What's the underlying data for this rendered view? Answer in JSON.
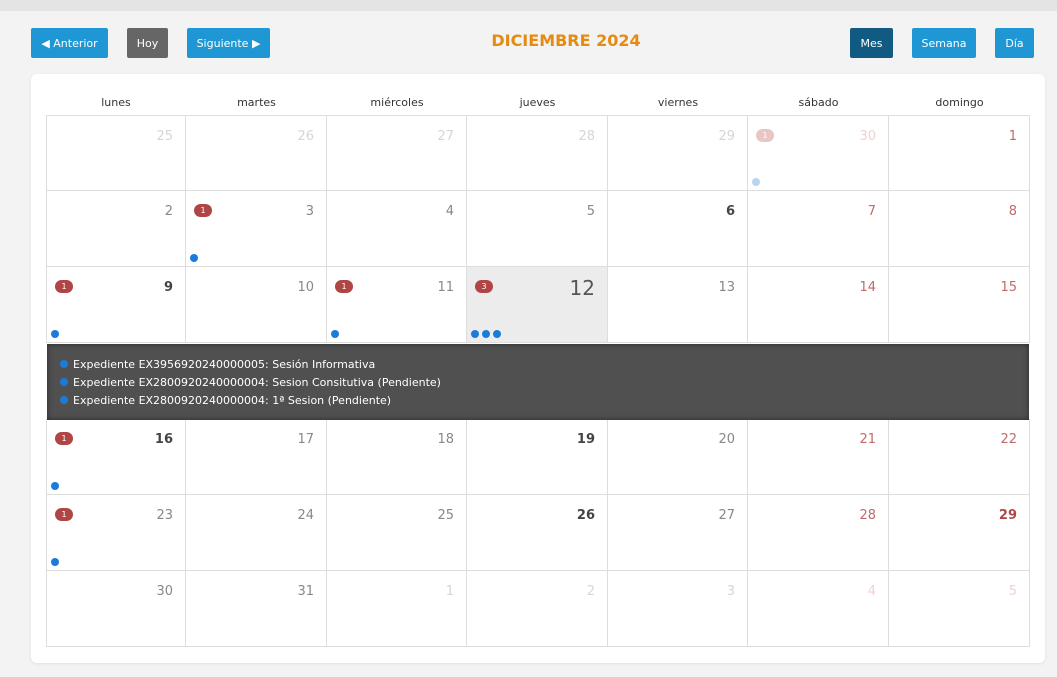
{
  "toolbar": {
    "prev_label": "◀ Anterior",
    "today_label": "Hoy",
    "next_label": "Siguiente ▶",
    "title": "DICIEMBRE 2024",
    "view_month": "Mes",
    "view_week": "Semana",
    "view_day": "Día"
  },
  "weekdays": [
    "lunes",
    "martes",
    "miércoles",
    "jueves",
    "viernes",
    "sábado",
    "domingo"
  ],
  "weeks": [
    [
      {
        "day": "25",
        "dim": true
      },
      {
        "day": "26",
        "dim": true
      },
      {
        "day": "27",
        "dim": true
      },
      {
        "day": "28",
        "dim": true
      },
      {
        "day": "29",
        "dim": true
      },
      {
        "day": "30",
        "dim": true,
        "weekend": true,
        "badge": "1",
        "dots": 1
      },
      {
        "day": "1",
        "weekend": true
      }
    ],
    [
      {
        "day": "2"
      },
      {
        "day": "3",
        "badge": "1",
        "dots": 1
      },
      {
        "day": "4"
      },
      {
        "day": "5"
      },
      {
        "day": "6",
        "bold": true
      },
      {
        "day": "7",
        "weekend": true
      },
      {
        "day": "8",
        "weekend": true
      }
    ],
    [
      {
        "day": "9",
        "bold": true,
        "badge": "1",
        "dots": 1
      },
      {
        "day": "10"
      },
      {
        "day": "11",
        "badge": "1",
        "dots": 1
      },
      {
        "day": "12",
        "today": true,
        "badge": "3",
        "dots": 3
      },
      {
        "day": "13"
      },
      {
        "day": "14",
        "weekend": true
      },
      {
        "day": "15",
        "weekend": true
      }
    ],
    [
      {
        "day": "16",
        "bold": true,
        "badge": "1",
        "dots": 1
      },
      {
        "day": "17"
      },
      {
        "day": "18"
      },
      {
        "day": "19",
        "bold": true
      },
      {
        "day": "20"
      },
      {
        "day": "21",
        "weekend": true
      },
      {
        "day": "22",
        "weekend": true
      }
    ],
    [
      {
        "day": "23",
        "badge": "1",
        "dots": 1
      },
      {
        "day": "24"
      },
      {
        "day": "25"
      },
      {
        "day": "26",
        "bold": true
      },
      {
        "day": "27"
      },
      {
        "day": "28",
        "weekend": true
      },
      {
        "day": "29",
        "weekend": true,
        "bold": true
      }
    ],
    [
      {
        "day": "30"
      },
      {
        "day": "31"
      },
      {
        "day": "1",
        "dim": true
      },
      {
        "day": "2",
        "dim": true
      },
      {
        "day": "3",
        "dim": true
      },
      {
        "day": "4",
        "dim": true,
        "weekend": true
      },
      {
        "day": "5",
        "dim": true,
        "weekend": true
      }
    ]
  ],
  "events": [
    "Expediente EX39569202400000​05: Sesión Informativa",
    "Expediente EX28009202400000​04: Sesion Consitutiva (Pendiente)",
    "Expediente EX28009202400000​04: 1ª Sesion (Pendiente)"
  ],
  "colors": {
    "accent_blue": "#1f97d4",
    "active_view": "#115a82",
    "title_orange": "#e58a12",
    "badge_red": "#b04545",
    "event_dot": "#1b7bd8"
  }
}
